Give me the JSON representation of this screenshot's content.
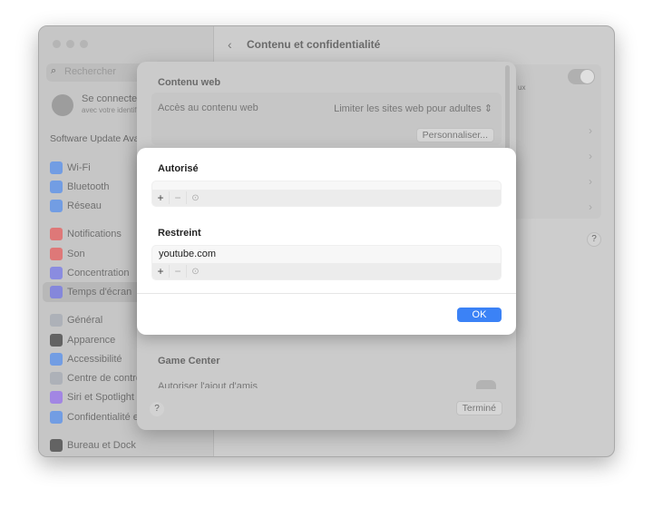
{
  "window": {
    "title": "Contenu et confidentialité"
  },
  "sidebar": {
    "search_placeholder": "Rechercher",
    "account": {
      "title": "Se connecter",
      "subtitle": "avec votre identifiant Apple"
    },
    "update_notice": "Software Update Available",
    "items": [
      {
        "label": "Wi-Fi",
        "icon": "wifi-icon",
        "color": "#3b82f6"
      },
      {
        "label": "Bluetooth",
        "icon": "bluetooth-icon",
        "color": "#3b82f6"
      },
      {
        "label": "Réseau",
        "icon": "globe-icon",
        "color": "#3b82f6"
      },
      {
        "label": "Notifications",
        "icon": "bell-icon",
        "color": "#ef4444"
      },
      {
        "label": "Son",
        "icon": "speaker-icon",
        "color": "#ef4444"
      },
      {
        "label": "Concentration",
        "icon": "moon-icon",
        "color": "#6366f1"
      },
      {
        "label": "Temps d'écran",
        "icon": "hourglass-icon",
        "color": "#6366f1"
      },
      {
        "label": "Général",
        "icon": "gear-icon",
        "color": "#9ca3af"
      },
      {
        "label": "Apparence",
        "icon": "appearance-icon",
        "color": "#222222"
      },
      {
        "label": "Accessibilité",
        "icon": "accessibility-icon",
        "color": "#3b82f6"
      },
      {
        "label": "Centre de contrôle",
        "icon": "control-center-icon",
        "color": "#9ca3af"
      },
      {
        "label": "Siri et Spotlight",
        "icon": "siri-icon",
        "color": "#8b5cf6"
      },
      {
        "label": "Confidentialité et sécurité",
        "icon": "hand-icon",
        "color": "#3b82f6"
      },
      {
        "label": "Bureau et Dock",
        "icon": "dock-icon",
        "color": "#222222"
      }
    ],
    "selected": "Temps d'écran"
  },
  "main": {
    "partial_text": "ux",
    "toggle_on": false,
    "help": "?"
  },
  "sheet": {
    "section_web": "Contenu web",
    "web_access_label": "Accès au contenu web",
    "web_access_value": "Limiter les sites web pour adultes",
    "customize_button": "Personnaliser...",
    "section_game": "Game Center",
    "add_friends_label": "Autoriser l'ajout d'amis",
    "help": "?",
    "done_button": "Terminé"
  },
  "dialog": {
    "allowed_title": "Autorisé",
    "allowed_sites": [],
    "restricted_title": "Restreint",
    "restricted_sites": [
      "youtube.com"
    ],
    "add": "+",
    "remove": "−",
    "more": "⊙",
    "ok_button": "OK",
    "accent": "#3b82f6"
  }
}
